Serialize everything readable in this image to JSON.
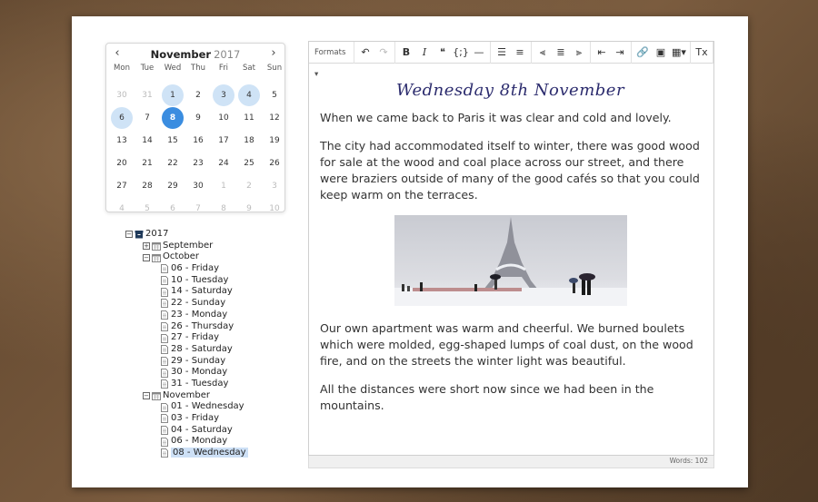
{
  "calendar": {
    "month": "November",
    "year": "2017",
    "prev_icon": "‹",
    "next_icon": "›",
    "weekdays": [
      "Mon",
      "Tue",
      "Wed",
      "Thu",
      "Fri",
      "Sat",
      "Sun"
    ],
    "weeks": [
      [
        {
          "d": "30",
          "m": true
        },
        {
          "d": "31",
          "m": true
        },
        {
          "d": "1",
          "h": true
        },
        {
          "d": "2"
        },
        {
          "d": "3",
          "h": true
        },
        {
          "d": "4",
          "h": true
        },
        {
          "d": "5"
        }
      ],
      [
        {
          "d": "6",
          "h": true
        },
        {
          "d": "7"
        },
        {
          "d": "8",
          "s": true
        },
        {
          "d": "9"
        },
        {
          "d": "10"
        },
        {
          "d": "11"
        },
        {
          "d": "12"
        }
      ],
      [
        {
          "d": "13"
        },
        {
          "d": "14"
        },
        {
          "d": "15"
        },
        {
          "d": "16"
        },
        {
          "d": "17"
        },
        {
          "d": "18"
        },
        {
          "d": "19"
        }
      ],
      [
        {
          "d": "20"
        },
        {
          "d": "21"
        },
        {
          "d": "22"
        },
        {
          "d": "23"
        },
        {
          "d": "24"
        },
        {
          "d": "25"
        },
        {
          "d": "26"
        }
      ],
      [
        {
          "d": "27"
        },
        {
          "d": "28"
        },
        {
          "d": "29"
        },
        {
          "d": "30"
        },
        {
          "d": "1",
          "m": true
        },
        {
          "d": "2",
          "m": true
        },
        {
          "d": "3",
          "m": true
        }
      ],
      [
        {
          "d": "4",
          "m": true
        },
        {
          "d": "5",
          "m": true
        },
        {
          "d": "6",
          "m": true
        },
        {
          "d": "7",
          "m": true
        },
        {
          "d": "8",
          "m": true
        },
        {
          "d": "9",
          "m": true
        },
        {
          "d": "10",
          "m": true
        }
      ]
    ]
  },
  "tree": [
    {
      "label": "2017",
      "level": 0,
      "toggle": "−",
      "icon": "archive-icon"
    },
    {
      "label": "September",
      "level": 1,
      "toggle": "+",
      "icon": "calendar-icon"
    },
    {
      "label": "October",
      "level": 1,
      "toggle": "−",
      "icon": "calendar-icon"
    },
    {
      "label": "06 - Friday",
      "level": 2,
      "icon": "document-icon"
    },
    {
      "label": "10 - Tuesday",
      "level": 2,
      "icon": "document-icon"
    },
    {
      "label": "14 - Saturday",
      "level": 2,
      "icon": "document-icon"
    },
    {
      "label": "22 - Sunday",
      "level": 2,
      "icon": "document-icon"
    },
    {
      "label": "23 - Monday",
      "level": 2,
      "icon": "document-icon"
    },
    {
      "label": "26 - Thursday",
      "level": 2,
      "icon": "document-icon"
    },
    {
      "label": "27 - Friday",
      "level": 2,
      "icon": "document-icon"
    },
    {
      "label": "28 - Saturday",
      "level": 2,
      "icon": "document-icon"
    },
    {
      "label": "29 - Sunday",
      "level": 2,
      "icon": "document-icon"
    },
    {
      "label": "30 - Monday",
      "level": 2,
      "icon": "document-icon"
    },
    {
      "label": "31 - Tuesday",
      "level": 2,
      "icon": "document-icon"
    },
    {
      "label": "November",
      "level": 1,
      "toggle": "−",
      "icon": "calendar-icon"
    },
    {
      "label": "01 - Wednesday",
      "level": 2,
      "icon": "document-icon"
    },
    {
      "label": "03 - Friday",
      "level": 2,
      "icon": "document-icon"
    },
    {
      "label": "04 - Saturday",
      "level": 2,
      "icon": "document-icon"
    },
    {
      "label": "06 - Monday",
      "level": 2,
      "icon": "document-icon"
    },
    {
      "label": "08 - Wednesday",
      "level": 2,
      "icon": "document-icon",
      "selected": true
    }
  ],
  "toolbar": {
    "formats_label": "Formats ▾",
    "groups": [
      [
        {
          "glyph": "↶",
          "name": "undo-icon"
        },
        {
          "glyph": "↷",
          "name": "redo-icon",
          "disabled": true
        }
      ],
      [
        {
          "glyph": "B",
          "name": "bold-icon",
          "cls": "b"
        },
        {
          "glyph": "I",
          "name": "italic-icon",
          "cls": "i"
        },
        {
          "glyph": "❝",
          "name": "blockquote-icon"
        },
        {
          "glyph": "{;}",
          "name": "code-icon"
        },
        {
          "glyph": "—",
          "name": "horizontal-rule-icon"
        }
      ],
      [
        {
          "glyph": "☰",
          "name": "bullet-list-icon"
        },
        {
          "glyph": "≡",
          "name": "numbered-list-icon"
        }
      ],
      [
        {
          "glyph": "⫷",
          "name": "align-left-icon"
        },
        {
          "glyph": "≣",
          "name": "align-center-icon"
        },
        {
          "glyph": "⫸",
          "name": "align-right-icon"
        }
      ],
      [
        {
          "glyph": "⇤",
          "name": "outdent-icon"
        },
        {
          "glyph": "⇥",
          "name": "indent-icon"
        }
      ],
      [
        {
          "glyph": "🔗",
          "name": "link-icon"
        },
        {
          "glyph": "▣",
          "name": "image-icon"
        },
        {
          "glyph": "▦▾",
          "name": "table-icon"
        }
      ],
      [
        {
          "glyph": "Tx",
          "name": "clear-format-icon"
        }
      ]
    ]
  },
  "document": {
    "heading": "Wednesday 8th November",
    "para1": "When we came back to Paris it was clear and cold and lovely.",
    "para2": "The city had accommodated itself to winter, there was good wood for sale at the wood and coal place across our street, and there were braziers outside of many of the good cafés so that you could keep warm on the terraces.",
    "para3": "Our own apartment was warm and cheerful. We burned boulets which were molded, egg-shaped lumps of coal dust, on the wood fire, and on the streets the winter light was beautiful.",
    "para4": "All the distances were short now since we had been in the mountains."
  },
  "status": {
    "words": "Words: 102"
  }
}
